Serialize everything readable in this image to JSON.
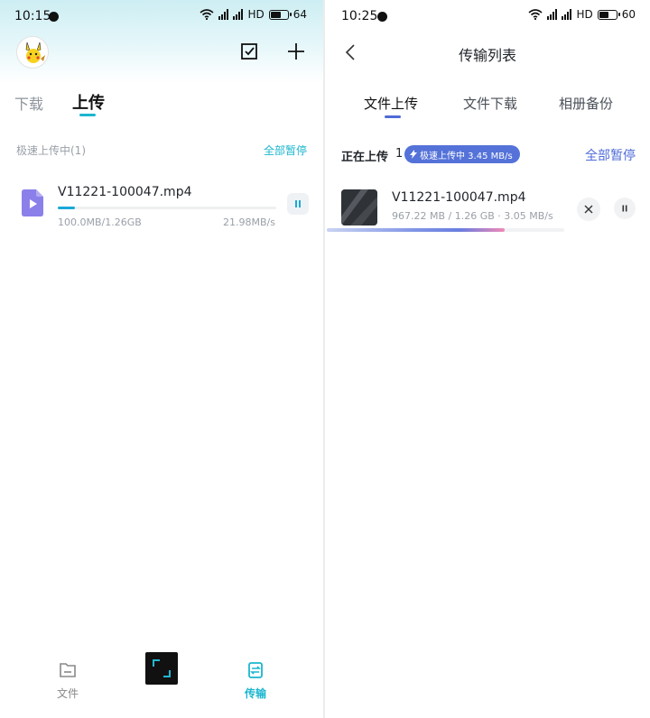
{
  "left": {
    "status": {
      "time": "10:15",
      "battery": "64",
      "battery_level": 0.64,
      "hd": "HD"
    },
    "tabs": [
      {
        "label": "下载",
        "active": false
      },
      {
        "label": "上传",
        "active": true
      }
    ],
    "section": {
      "label": "极速上传中(1)",
      "action": "全部暂停"
    },
    "item": {
      "name": "V11221-100047.mp4",
      "size": "100.0MB/1.26GB",
      "speed": "21.98MB/s",
      "progress": 0.077
    },
    "nav": [
      {
        "label": "文件",
        "active": false
      },
      {
        "label": "传输",
        "active": true
      }
    ],
    "colors": {
      "accent": "#1bb6cf"
    }
  },
  "right": {
    "status": {
      "time": "10:25",
      "battery": "60",
      "battery_level": 0.6,
      "hd": "HD"
    },
    "title": "传输列表",
    "tabs": [
      {
        "label": "文件上传",
        "active": true
      },
      {
        "label": "文件下载",
        "active": false
      },
      {
        "label": "相册备份",
        "active": false
      }
    ],
    "section": {
      "label": "正在上传",
      "count": "1",
      "badge": "极速上传中 3.45 MB/s",
      "action": "全部暂停"
    },
    "item": {
      "name": "V11221-100047.mp4",
      "meta": "967.22 MB / 1.26 GB · 3.05 MB/s",
      "progress": 0.75
    },
    "colors": {
      "accent": "#4f6bd8"
    }
  }
}
